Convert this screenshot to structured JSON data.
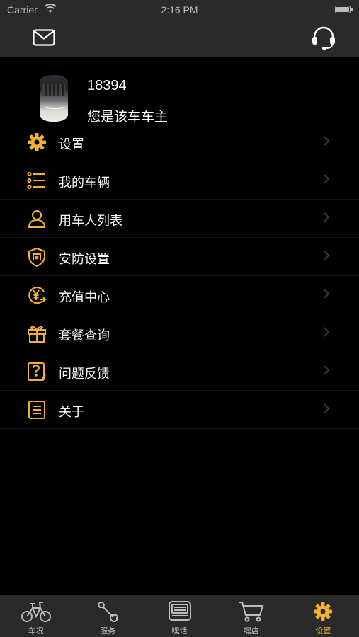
{
  "status_bar": {
    "carrier": "Carrier",
    "time": "2:16 PM"
  },
  "nav": {
    "left_icon": "mail-icon",
    "right_icon": "headset-icon"
  },
  "profile": {
    "user_id": "18394",
    "role": "您是该车车主"
  },
  "menu": [
    {
      "label": "设置",
      "icon": "gear-icon"
    },
    {
      "label": "我的车辆",
      "icon": "list-icon"
    },
    {
      "label": "用车人列表",
      "icon": "users-icon"
    },
    {
      "label": "安防设置",
      "icon": "shield-icon"
    },
    {
      "label": "充值中心",
      "icon": "yuan-icon"
    },
    {
      "label": "套餐查询",
      "icon": "gift-icon"
    },
    {
      "label": "问题反馈",
      "icon": "feedback-icon"
    },
    {
      "label": "关于",
      "icon": "document-icon"
    }
  ],
  "tabs": [
    {
      "label": "车况",
      "icon": "bicycle-icon",
      "active": false
    },
    {
      "label": "服务",
      "icon": "wrench-icon",
      "active": false
    },
    {
      "label": "嘿话",
      "icon": "chat-icon",
      "active": false
    },
    {
      "label": "嘿店",
      "icon": "cart-icon",
      "active": false
    },
    {
      "label": "设置",
      "icon": "gear-icon",
      "active": true
    }
  ],
  "colors": {
    "accent": "#f2b230",
    "bar_bg": "#2a2a2a",
    "background": "#000000",
    "inactive": "#bdbdbd"
  }
}
